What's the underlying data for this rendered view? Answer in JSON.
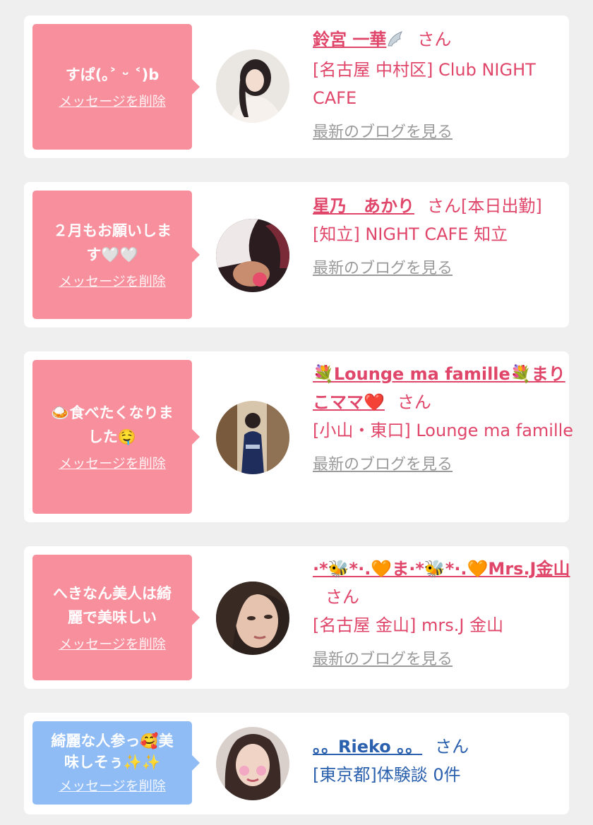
{
  "delete_label": "メッセージを削除",
  "blog_label": "最新のブログを見る",
  "colors": {
    "pink_bubble": "#f78f9c",
    "blue_bubble": "#90bcf5",
    "pink_text": "#e0466a",
    "blue_text": "#2a60ad",
    "link_gray": "#9a9a9a"
  },
  "cards": [
    {
      "message": "すぱ(｡˃ ᵕ ˂)b",
      "name": "鈴宮 一華",
      "name_icon": "wing-icon",
      "suffix": "さん",
      "shop": "[名古屋 中村区] Club NIGHT CAFE"
    },
    {
      "message_lines": [
        "２月もお願いしま",
        "す🤍🤍"
      ],
      "name": "星乃　あかり",
      "suffix": "さん[本日出勤]",
      "shop": "[知立] NIGHT CAFE 知立"
    },
    {
      "message_lines": [
        "🍛食べたくなりま",
        "した🤤"
      ],
      "name": "💐Lounge ma famille💐まりこママ❤️",
      "suffix": "さん",
      "shop": "[小山・東口] Lounge ma famille"
    },
    {
      "message_lines": [
        "へきなん美人は綺",
        "麗で美味しい"
      ],
      "name": "·*🐝*·.🧡ま·*🐝*·.🧡Mrs.J金山",
      "suffix": "さん",
      "shop": "[名古屋 金山] mrs.J 金山"
    },
    {
      "message_lines": [
        "綺麗な人参っ🥰美",
        "味しそぅ✨✨"
      ],
      "name": "。。Rieko 。。",
      "suffix": "さん",
      "shop": "[東京都]体験談 0件"
    }
  ]
}
